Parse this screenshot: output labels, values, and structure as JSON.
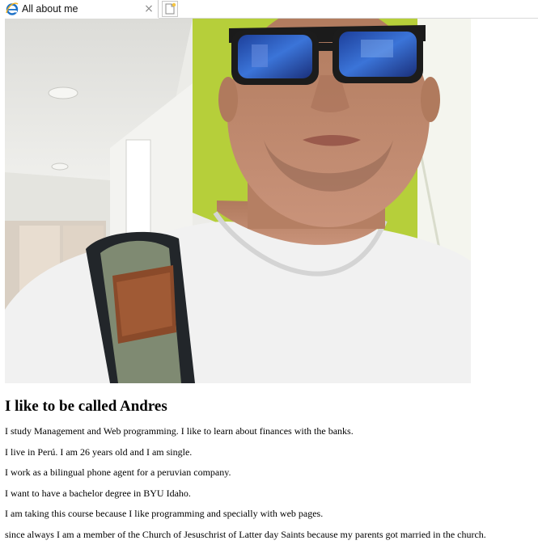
{
  "browser": {
    "tab_title": "All about me",
    "tab_icon": "ie-logo-icon",
    "close_glyph": "×",
    "new_tab_icon": "new-tab-icon"
  },
  "page": {
    "photo_alt": "selfie-photo",
    "heading": "I like to be called Andres",
    "paragraphs": [
      "I study Management and Web programming. I like to learn about finances with the banks.",
      "I live in Perú. I am 26 years old and I am single.",
      "I work as a bilingual phone agent for a peruvian company.",
      "I want to have a bachelor degree in BYU Idaho.",
      "I am taking this course because I like programming and specially with web pages.",
      "since always I am a member of the Church of Jesuschrist of Latter day Saints because my parents got married in the church."
    ]
  },
  "colors": {
    "ie_blue": "#1e72c8",
    "ie_ring": "#f2b01e",
    "wall_green": "#b6cf3a",
    "shirt": "#f1f1f1",
    "skin": "#c48b6a"
  }
}
